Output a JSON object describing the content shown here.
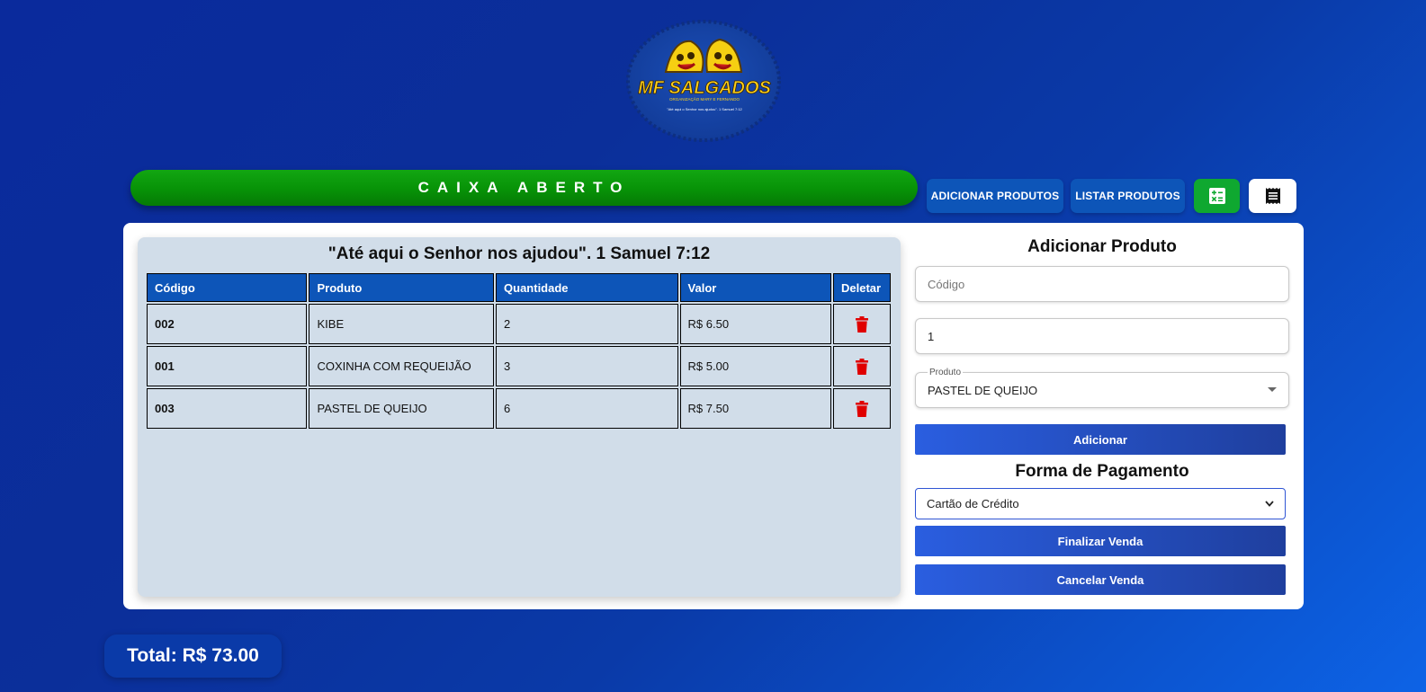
{
  "header": {
    "logo_text": "MF SALGADOS",
    "logo_subtitle": "ORGANIZAÇÃO MARY E FERNANDO",
    "logo_verse": "\"Até aqui o Senhor nos ajudou\". 1 Samuel 7:12"
  },
  "status": {
    "label": "CAIXA ABERTO",
    "color": "#079207"
  },
  "toolbar": {
    "add_products_label": "ADICIONAR PRODUTOS",
    "list_products_label": "LISTAR PRODUTOS",
    "calculator_icon": "calculator-icon",
    "receipt_icon": "receipt-icon"
  },
  "cart": {
    "verse": "\"Até aqui o Senhor nos ajudou\". 1 Samuel 7:12",
    "columns": [
      "Código",
      "Produto",
      "Quantidade",
      "Valor",
      "Deletar"
    ],
    "rows": [
      {
        "code": "002",
        "product": "KIBE",
        "quantity": "2",
        "value": "R$ 6.50"
      },
      {
        "code": "001",
        "product": "COXINHA COM REQUEIJÃO",
        "quantity": "3",
        "value": "R$ 5.00"
      },
      {
        "code": "003",
        "product": "PASTEL DE QUEIJO",
        "quantity": "6",
        "value": "R$ 7.50"
      }
    ]
  },
  "form": {
    "title": "Adicionar Produto",
    "code_placeholder": "Código",
    "quantity_value": "1",
    "product_legend": "Produto",
    "product_value": "PASTEL DE QUEIJO",
    "add_button": "Adicionar",
    "payment_title": "Forma de Pagamento",
    "payment_value": "Cartão de Crédito",
    "finish_button": "Finalizar Venda",
    "cancel_button": "Cancelar Venda"
  },
  "total": {
    "label": "Total: R$ 73.00"
  },
  "colors": {
    "primary": "#0d55b8",
    "success": "#079207",
    "danger": "#e00000"
  }
}
